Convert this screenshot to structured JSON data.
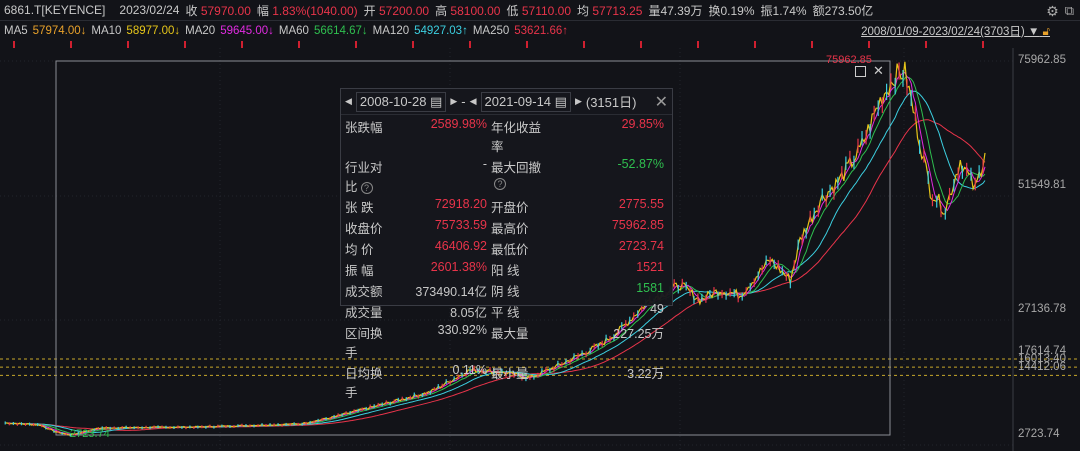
{
  "header": {
    "symbol": "6861.T[KEYENCE]",
    "date": "2023/02/24",
    "close_label": "收",
    "close": "57970.00",
    "change_label": "幅",
    "change": "1.83%(1040.00)",
    "open_label": "开",
    "open": "57200.00",
    "high_label": "高",
    "high": "58100.00",
    "low_label": "低",
    "low": "57110.00",
    "avg_label": "均",
    "avg": "57713.25",
    "vol_label": "量",
    "vol": "47.39万",
    "turn_label": "换",
    "turn": "0.19%",
    "amp_label": "振",
    "amp": "1.74%",
    "amt_label": "额",
    "amt": "273.50亿"
  },
  "ma": [
    {
      "label": "MA5",
      "value": "57974.00↓",
      "color": "#e8a12a"
    },
    {
      "label": "MA10",
      "value": "58977.00↓",
      "color": "#e6c619"
    },
    {
      "label": "MA20",
      "value": "59645.00↓",
      "color": "#e02be0"
    },
    {
      "label": "MA60",
      "value": "56614.67↓",
      "color": "#2fbf4f"
    },
    {
      "label": "MA120",
      "value": "54927.03↑",
      "color": "#3ccfe0"
    },
    {
      "label": "MA250",
      "value": "53621.66↑",
      "color": "#e8344a"
    }
  ],
  "range": "2008/01/09-2023/02/24(3703日)",
  "axis": [
    "75962.85",
    "51549.81",
    "27136.78",
    "17614.74",
    "16013.40",
    "14412.06",
    "2723.74"
  ],
  "annotations": {
    "high": "75962.85",
    "low": "2723.74"
  },
  "popup": {
    "start": "2008-10-28",
    "sep": "-",
    "end": "2021-09-14",
    "days": "(3151日)",
    "rows": [
      [
        "张跌幅",
        "2589.98%",
        "年化收益率",
        "29.85%"
      ],
      [
        "行业对比",
        "-",
        "最大回撤",
        "-52.87%"
      ],
      [
        "张 跌",
        "72918.20",
        "开盘价",
        "2775.55"
      ],
      [
        "收盘价",
        "75733.59",
        "最高价",
        "75962.85"
      ],
      [
        "均 价",
        "46406.92",
        "最低价",
        "2723.74"
      ],
      [
        "振 幅",
        "2601.38%",
        "阳 线",
        "1521"
      ],
      [
        "成交额",
        "373490.14亿",
        "阴 线",
        "1581"
      ],
      [
        "成交量",
        "8.05亿",
        "平 线",
        "49"
      ],
      [
        "区间换手",
        "330.92%",
        "最大量",
        "227.25万"
      ],
      [
        "日均换手",
        "0.11%",
        "最小量",
        "3.22万"
      ]
    ]
  },
  "chart_data": {
    "type": "line",
    "title": "6861.T KEYENCE",
    "ylim": [
      2723.74,
      75962.85
    ],
    "xlim": [
      2008.02,
      2023.15
    ],
    "x": [
      2008.1,
      2008.63,
      2008.88,
      2009.1,
      2009.56,
      2011.09,
      2012.63,
      2013.09,
      2013.86,
      2014.63,
      2015.24,
      2015.7,
      2016.16,
      2016.62,
      2017.24,
      2017.54,
      2018.0,
      2018.47,
      2018.77,
      2019.08,
      2019.39,
      2019.85,
      2020.16,
      2020.31,
      2020.62,
      2020.92,
      2021.23,
      2021.54,
      2021.77,
      2021.92,
      2022.08,
      2022.31,
      2022.54,
      2022.77,
      2023.0,
      2023.15
    ],
    "close": [
      5083,
      4691,
      3320,
      2724,
      4104,
      4300,
      4888,
      6063,
      8608,
      11154,
      15462,
      15070,
      13895,
      16440,
      20356,
      23293,
      29167,
      32104,
      29167,
      31125,
      30146,
      37000,
      33083,
      40915,
      48747,
      52663,
      58537,
      68327,
      73222,
      73810,
      64410,
      50705,
      46789,
      56579,
      50705,
      57970
    ]
  }
}
